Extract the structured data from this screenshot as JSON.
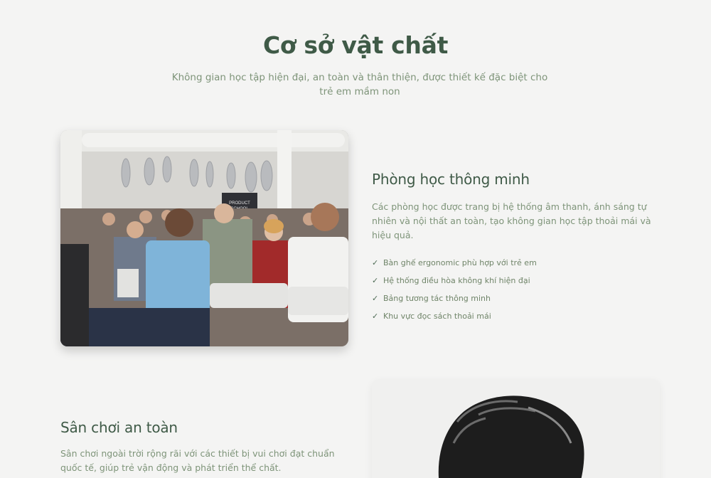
{
  "header": {
    "title": "Cơ sở vật chất",
    "subtitle": "Không gian học tập hiện đại, an toàn và thân thiện, được thiết kế đặc biệt cho trẻ em mầm non"
  },
  "features": [
    {
      "title": "Phòng học thông minh",
      "description": "Các phòng học được trang bị hệ thống âm thanh, ánh sáng tự nhiên và nội thất an toàn, tạo không gian học tập thoải mái và hiệu quả.",
      "items": [
        "Bàn ghế ergonomic phù hợp với trẻ em",
        "Hệ thống điều hòa không khí hiện đại",
        "Bảng tương tác thông minh",
        "Khu vực đọc sách thoải mái"
      ],
      "image_sign_text": "PRODUCT SCHOOL"
    },
    {
      "title": "Sân chơi an toàn",
      "description": "Sân chơi ngoài trời rộng rãi với các thiết bị vui chơi đạt chuẩn quốc tế, giúp trẻ vận động và phát triển thể chất."
    }
  ],
  "icons": {
    "check": "✓"
  },
  "colors": {
    "heading": "#3f5a47",
    "body_text": "#7e9479",
    "background": "#f4f4f3"
  }
}
